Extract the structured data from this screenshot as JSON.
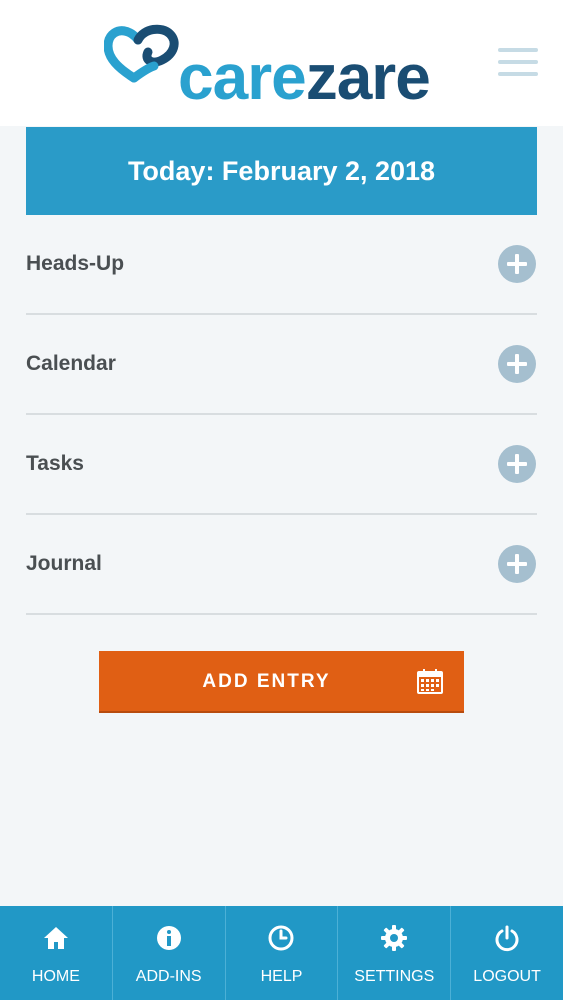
{
  "brand": {
    "part1": "care",
    "part2": "zare",
    "primary_color": "#2aa1cf",
    "secondary_color": "#1a4d73"
  },
  "header": {
    "menu_icon": "hamburger-menu-icon"
  },
  "banner": {
    "date_text": "Today: February 2, 2018",
    "color": "#2a9bc8"
  },
  "sections": [
    {
      "label": "Heads-Up",
      "icon": "plus-circle-icon"
    },
    {
      "label": "Calendar",
      "icon": "plus-circle-icon"
    },
    {
      "label": "Tasks",
      "icon": "plus-circle-icon"
    },
    {
      "label": "Journal",
      "icon": "plus-circle-icon"
    }
  ],
  "add_entry": {
    "label": "ADD ENTRY",
    "icon": "calendar-icon",
    "color": "#e05f14"
  },
  "bottom_nav": [
    {
      "label": "HOME",
      "icon": "home-icon"
    },
    {
      "label": "ADD-INS",
      "icon": "info-icon"
    },
    {
      "label": "HELP",
      "icon": "clock-icon"
    },
    {
      "label": "SETTINGS",
      "icon": "gear-icon"
    },
    {
      "label": "LOGOUT",
      "icon": "power-icon"
    }
  ]
}
